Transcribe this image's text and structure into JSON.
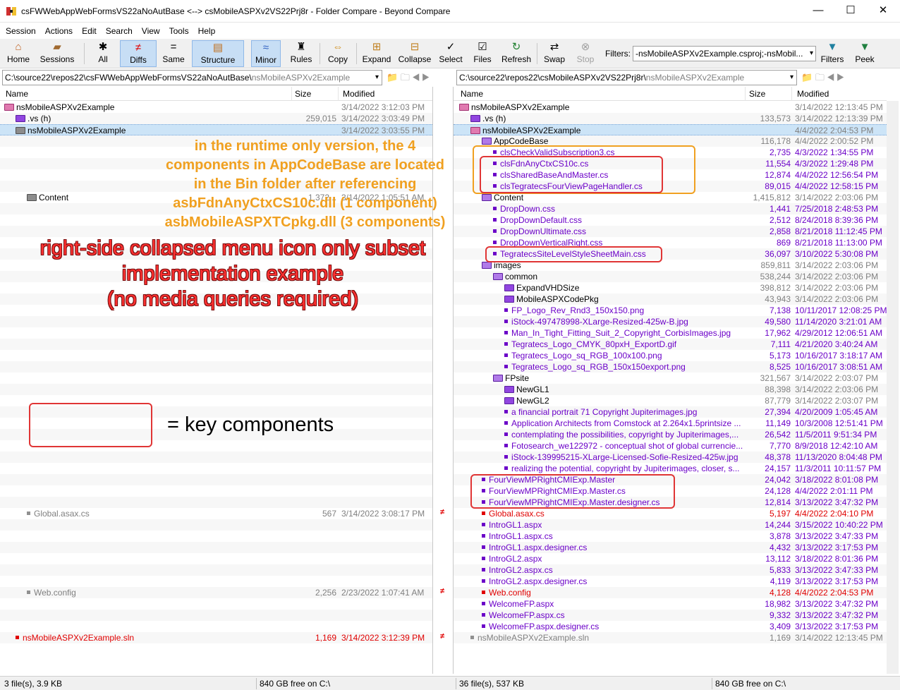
{
  "window": {
    "title": "csFWWebAppWebFormsVS22aNoAutBase <--> csMobileASPXv2VS22Prj8r - Folder Compare - Beyond Compare",
    "minimize": "—",
    "maximize": "☐",
    "close": "✕"
  },
  "menu": [
    "Session",
    "Actions",
    "Edit",
    "Search",
    "View",
    "Tools",
    "Help"
  ],
  "toolbar": {
    "home": "Home",
    "sessions": "Sessions",
    "all": "All",
    "diffs": "Diffs",
    "same": "Same",
    "structure": "Structure",
    "minor": "Minor",
    "rules": "Rules",
    "copy": "Copy",
    "expand": "Expand",
    "collapse": "Collapse",
    "select": "Select",
    "files": "Files",
    "refresh": "Refresh",
    "swap": "Swap",
    "stop": "Stop",
    "filters_label": "Filters:",
    "filters_value": "-nsMobileASPXv2Example.csproj;-nsMobil...",
    "filters_btn": "Filters",
    "peek": "Peek"
  },
  "left_path": {
    "base": "C:\\source22\\repos22\\csFWWebAppWebFormsVS22aNoAutBase\\",
    "dim": "nsMobileASPXv2Example"
  },
  "right_path": {
    "base": "C:\\source22\\repos22\\csMobileASPXv2VS22Prj8r\\",
    "dim": "nsMobileASPXv2Example"
  },
  "columns": {
    "name": "Name",
    "size": "Size",
    "modified": "Modified"
  },
  "left_rows": [
    {
      "name": "nsMobileASPXv2Example",
      "size": "",
      "mod": "3/14/2022 3:12:03 PM",
      "icon": "fold-pk",
      "indent": 0,
      "color": "black"
    },
    {
      "name": ".vs (h)",
      "size": "259,015",
      "mod": "3/14/2022 3:03:49 PM",
      "icon": "fold-pu",
      "indent": 1,
      "color": "black"
    },
    {
      "name": "nsMobileASPXv2Example",
      "size": "",
      "mod": "3/14/2022 3:03:55 PM",
      "icon": "fold-gr",
      "indent": 1,
      "color": "black",
      "sel": true
    },
    {
      "name": "",
      "size": "",
      "mod": ""
    },
    {
      "name": "",
      "size": "",
      "mod": ""
    },
    {
      "name": "",
      "size": "",
      "mod": ""
    },
    {
      "name": "",
      "size": "",
      "mod": ""
    },
    {
      "name": "",
      "size": "",
      "mod": ""
    },
    {
      "name": "Content",
      "size": "1,372...",
      "mod": "3/14/2022 1:05:51 AM",
      "icon": "fold-gr",
      "indent": 2,
      "color": "black"
    }
  ],
  "left_bottom_rows": {
    "global": {
      "name": "Global.asax.cs",
      "size": "567",
      "mod": "3/14/2022 3:08:17 PM"
    },
    "web": {
      "name": "Web.config",
      "size": "2,256",
      "mod": "2/23/2022 1:07:41 AM"
    },
    "sln": {
      "name": "nsMobileASPXv2Example.sln",
      "size": "1,169",
      "mod": "3/14/2022 3:12:39 PM"
    }
  },
  "diff_marker": "≠",
  "right_rows": [
    {
      "name": "nsMobileASPXv2Example",
      "size": "",
      "mod": "3/14/2022 12:13:45 PM",
      "icon": "fold-pk",
      "indent": 0,
      "color": "black"
    },
    {
      "name": ".vs (h)",
      "size": "133,573",
      "mod": "3/14/2022 12:13:39 PM",
      "icon": "fold-pu",
      "indent": 1,
      "color": "black"
    },
    {
      "name": "nsMobileASPXv2Example",
      "size": "",
      "mod": "4/4/2022 2:04:53 PM",
      "icon": "fold-pk",
      "indent": 1,
      "color": "black",
      "sel": true
    },
    {
      "name": "AppCodeBase",
      "size": "116,178",
      "mod": "4/4/2022 2:00:52 PM",
      "icon": "fold-op",
      "indent": 2,
      "color": "black"
    },
    {
      "name": "clsCheckValidSubscription3.cs",
      "size": "2,735",
      "mod": "4/3/2022 1:34:55 PM",
      "icon": "sq-pu",
      "indent": 3,
      "color": "purple"
    },
    {
      "name": "clsFdnAnyCtxCS10c.cs",
      "size": "11,554",
      "mod": "4/3/2022 1:29:48 PM",
      "icon": "sq-pu",
      "indent": 3,
      "color": "purple"
    },
    {
      "name": "clsSharedBaseAndMaster.cs",
      "size": "12,874",
      "mod": "4/4/2022 12:56:54 PM",
      "icon": "sq-pu",
      "indent": 3,
      "color": "purple"
    },
    {
      "name": "clsTegratecsFourViewPageHandler.cs",
      "size": "89,015",
      "mod": "4/4/2022 12:58:15 PM",
      "icon": "sq-pu",
      "indent": 3,
      "color": "purple"
    },
    {
      "name": "Content",
      "size": "1,415,812",
      "mod": "3/14/2022 2:03:06 PM",
      "icon": "fold-op",
      "indent": 2,
      "color": "black"
    },
    {
      "name": "DropDown.css",
      "size": "1,441",
      "mod": "7/25/2018 2:48:53 PM",
      "icon": "sq-pu",
      "indent": 3,
      "color": "purple"
    },
    {
      "name": "DropDownDefault.css",
      "size": "2,512",
      "mod": "8/24/2018 8:39:36 PM",
      "icon": "sq-pu",
      "indent": 3,
      "color": "purple"
    },
    {
      "name": "DropDownUltimate.css",
      "size": "2,858",
      "mod": "8/21/2018 11:12:45 PM",
      "icon": "sq-pu",
      "indent": 3,
      "color": "purple"
    },
    {
      "name": "DropDownVerticalRight.css",
      "size": "869",
      "mod": "8/21/2018 11:13:00 PM",
      "icon": "sq-pu",
      "indent": 3,
      "color": "purple"
    },
    {
      "name": "TegratecsSiteLevelStyleSheetMain.css",
      "size": "36,097",
      "mod": "3/10/2022 5:30:08 PM",
      "icon": "sq-pu",
      "indent": 3,
      "color": "purple"
    },
    {
      "name": "images",
      "size": "859,811",
      "mod": "3/14/2022 2:03:06 PM",
      "icon": "fold-op",
      "indent": 2,
      "color": "black"
    },
    {
      "name": "common",
      "size": "538,244",
      "mod": "3/14/2022 2:03:06 PM",
      "icon": "fold-op",
      "indent": 3,
      "color": "black"
    },
    {
      "name": "ExpandVHDSize",
      "size": "398,812",
      "mod": "3/14/2022 2:03:06 PM",
      "icon": "fold-pu",
      "indent": 4,
      "color": "black"
    },
    {
      "name": "MobileASPXCodePkg",
      "size": "43,943",
      "mod": "3/14/2022 2:03:06 PM",
      "icon": "fold-pu",
      "indent": 4,
      "color": "black"
    },
    {
      "name": "FP_Logo_Rev_Rnd3_150x150.png",
      "size": "7,138",
      "mod": "10/11/2017 12:08:25 PM",
      "icon": "sq-pu",
      "indent": 4,
      "color": "purple"
    },
    {
      "name": "iStock-497478998-XLarge-Resized-425w-B.jpg",
      "size": "49,580",
      "mod": "11/14/2020 3:21:01 AM",
      "icon": "sq-pu",
      "indent": 4,
      "color": "purple"
    },
    {
      "name": "Man_In_Tight_Fitting_Suit_2_Copyright_CorbisImages.jpg",
      "size": "17,962",
      "mod": "4/29/2012 12:06:51 AM",
      "icon": "sq-pu",
      "indent": 4,
      "color": "purple"
    },
    {
      "name": "Tegratecs_Logo_CMYK_80pxH_ExportD.gif",
      "size": "7,111",
      "mod": "4/21/2020 3:40:24 AM",
      "icon": "sq-pu",
      "indent": 4,
      "color": "purple"
    },
    {
      "name": "Tegratecs_Logo_sq_RGB_100x100.png",
      "size": "5,173",
      "mod": "10/16/2017 3:18:17 AM",
      "icon": "sq-pu",
      "indent": 4,
      "color": "purple"
    },
    {
      "name": "Tegratecs_Logo_sq_RGB_150x150export.png",
      "size": "8,525",
      "mod": "10/16/2017 3:08:51 AM",
      "icon": "sq-pu",
      "indent": 4,
      "color": "purple"
    },
    {
      "name": "FPsite",
      "size": "321,567",
      "mod": "3/14/2022 2:03:07 PM",
      "icon": "fold-op",
      "indent": 3,
      "color": "black"
    },
    {
      "name": "NewGL1",
      "size": "88,398",
      "mod": "3/14/2022 2:03:06 PM",
      "icon": "fold-pu",
      "indent": 4,
      "color": "black"
    },
    {
      "name": "NewGL2",
      "size": "87,779",
      "mod": "3/14/2022 2:03:07 PM",
      "icon": "fold-pu",
      "indent": 4,
      "color": "black"
    },
    {
      "name": "a financial portrait 71 Copyright Jupiterimages.jpg",
      "size": "27,394",
      "mod": "4/20/2009 1:05:45 AM",
      "icon": "sq-pu",
      "indent": 4,
      "color": "purple"
    },
    {
      "name": "Application Architects from Comstock at 2.264x1.5printsize ...",
      "size": "11,149",
      "mod": "10/3/2008 12:51:41 PM",
      "icon": "sq-pu",
      "indent": 4,
      "color": "purple"
    },
    {
      "name": "contemplating the possibilities, copyright by Jupiterimages,...",
      "size": "26,542",
      "mod": "11/5/2011 9:51:34 PM",
      "icon": "sq-pu",
      "indent": 4,
      "color": "purple"
    },
    {
      "name": "Fotosearch_we122972 - conceptual shot of global currencie...",
      "size": "7,770",
      "mod": "8/9/2018 12:42:10 AM",
      "icon": "sq-pu",
      "indent": 4,
      "color": "purple"
    },
    {
      "name": "iStock-139995215-XLarge-Licensed-Sofie-Resized-425w.jpg",
      "size": "48,378",
      "mod": "11/13/2020 8:04:48 PM",
      "icon": "sq-pu",
      "indent": 4,
      "color": "purple"
    },
    {
      "name": "realizing the potential, copyright by Jupiterimages, closer, s...",
      "size": "24,157",
      "mod": "11/3/2011 10:11:57 PM",
      "icon": "sq-pu",
      "indent": 4,
      "color": "purple"
    },
    {
      "name": "FourViewMPRightCMIExp.Master",
      "size": "24,042",
      "mod": "3/18/2022 8:01:08 PM",
      "icon": "sq-pu",
      "indent": 2,
      "color": "purple"
    },
    {
      "name": "FourViewMPRightCMIExp.Master.cs",
      "size": "24,128",
      "mod": "4/4/2022 2:01:11 PM",
      "icon": "sq-pu",
      "indent": 2,
      "color": "purple"
    },
    {
      "name": "FourViewMPRightCMIExp.Master.designer.cs",
      "size": "12,814",
      "mod": "3/13/2022 3:47:32 PM",
      "icon": "sq-pu",
      "indent": 2,
      "color": "purple"
    },
    {
      "name": "Global.asax.cs",
      "size": "5,197",
      "mod": "4/4/2022 2:04:10 PM",
      "icon": "sq-rd",
      "indent": 2,
      "color": "red"
    },
    {
      "name": "IntroGL1.aspx",
      "size": "14,244",
      "mod": "3/15/2022 10:40:22 PM",
      "icon": "sq-pu",
      "indent": 2,
      "color": "purple"
    },
    {
      "name": "IntroGL1.aspx.cs",
      "size": "3,878",
      "mod": "3/13/2022 3:47:33 PM",
      "icon": "sq-pu",
      "indent": 2,
      "color": "purple"
    },
    {
      "name": "IntroGL1.aspx.designer.cs",
      "size": "4,432",
      "mod": "3/13/2022 3:17:53 PM",
      "icon": "sq-pu",
      "indent": 2,
      "color": "purple"
    },
    {
      "name": "IntroGL2.aspx",
      "size": "13,112",
      "mod": "3/18/2022 8:01:36 PM",
      "icon": "sq-pu",
      "indent": 2,
      "color": "purple"
    },
    {
      "name": "IntroGL2.aspx.cs",
      "size": "5,833",
      "mod": "3/13/2022 3:47:33 PM",
      "icon": "sq-pu",
      "indent": 2,
      "color": "purple"
    },
    {
      "name": "IntroGL2.aspx.designer.cs",
      "size": "4,119",
      "mod": "3/13/2022 3:17:53 PM",
      "icon": "sq-pu",
      "indent": 2,
      "color": "purple"
    },
    {
      "name": "Web.config",
      "size": "4,128",
      "mod": "4/4/2022 2:04:53 PM",
      "icon": "sq-rd",
      "indent": 2,
      "color": "red"
    },
    {
      "name": "WelcomeFP.aspx",
      "size": "18,982",
      "mod": "3/13/2022 3:47:32 PM",
      "icon": "sq-pu",
      "indent": 2,
      "color": "purple"
    },
    {
      "name": "WelcomeFP.aspx.cs",
      "size": "9,332",
      "mod": "3/13/2022 3:47:32 PM",
      "icon": "sq-pu",
      "indent": 2,
      "color": "purple"
    },
    {
      "name": "WelcomeFP.aspx.designer.cs",
      "size": "3,409",
      "mod": "3/13/2022 3:17:53 PM",
      "icon": "sq-pu",
      "indent": 2,
      "color": "purple"
    },
    {
      "name": "nsMobileASPXv2Example.sln",
      "size": "1,169",
      "mod": "3/14/2022 12:13:45 PM",
      "icon": "sq-gy",
      "indent": 1,
      "color": "gray"
    }
  ],
  "annotations": {
    "orange": [
      "in the runtime only version, the 4",
      "components in AppCodeBase are located",
      "in the Bin folder after referencing",
      "asbFdnAnyCtxCS10c.dll (1 component)",
      "asbMobileASPXTCpkg.dll  (3 components)"
    ],
    "red": [
      "right-side collapsed menu icon only subset",
      "implementation example",
      "(no media queries required)"
    ],
    "key": "= key components"
  },
  "status": {
    "left_files": "3 file(s), 3.9 KB",
    "left_free": "840 GB free on C:\\",
    "right_files": "36 file(s), 537 KB",
    "right_free": "840 GB free on C:\\"
  }
}
